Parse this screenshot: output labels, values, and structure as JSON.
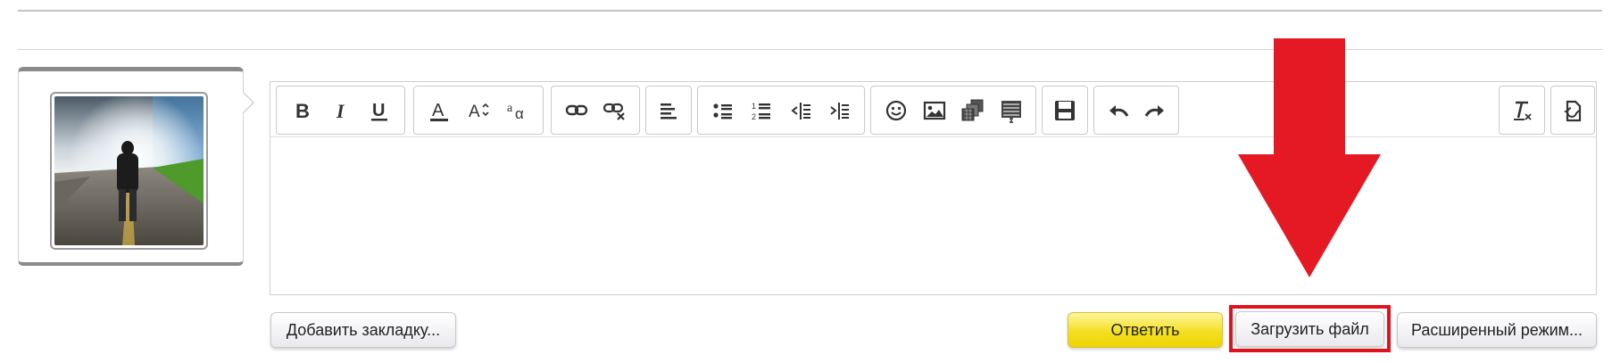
{
  "toolbar": {
    "groups": [
      {
        "name": "text-format",
        "buttons": [
          "bold-icon",
          "italic-icon",
          "underline-icon"
        ]
      },
      {
        "name": "font",
        "buttons": [
          "font-color-icon",
          "font-size-icon",
          "font-family-icon"
        ]
      },
      {
        "name": "links",
        "buttons": [
          "link-icon",
          "unlink-icon"
        ]
      },
      {
        "name": "align",
        "buttons": [
          "align-left-icon"
        ]
      },
      {
        "name": "lists",
        "buttons": [
          "bullet-list-icon",
          "numbered-list-icon",
          "outdent-icon",
          "indent-icon"
        ]
      },
      {
        "name": "insert",
        "buttons": [
          "smiley-icon",
          "image-icon",
          "media-icon",
          "code-block-icon"
        ]
      },
      {
        "name": "save",
        "buttons": [
          "save-icon"
        ]
      },
      {
        "name": "history",
        "buttons": [
          "undo-icon",
          "redo-icon"
        ]
      },
      {
        "name": "clear",
        "buttons": [
          "remove-format-icon"
        ]
      },
      {
        "name": "source",
        "buttons": [
          "source-toggle-icon"
        ]
      }
    ]
  },
  "buttons": {
    "bookmark_label": "Добавить закладку...",
    "reply_label": "Ответить",
    "upload_label": "Загрузить файл",
    "advanced_label": "Расширенный режим..."
  },
  "colors": {
    "reply_button": "#f3df23",
    "highlight_border": "#e0121d",
    "arrow": "#e51923"
  },
  "annotation": {
    "arrow_icon": "arrow-down-icon",
    "highlight_target": "upload-file-button"
  }
}
